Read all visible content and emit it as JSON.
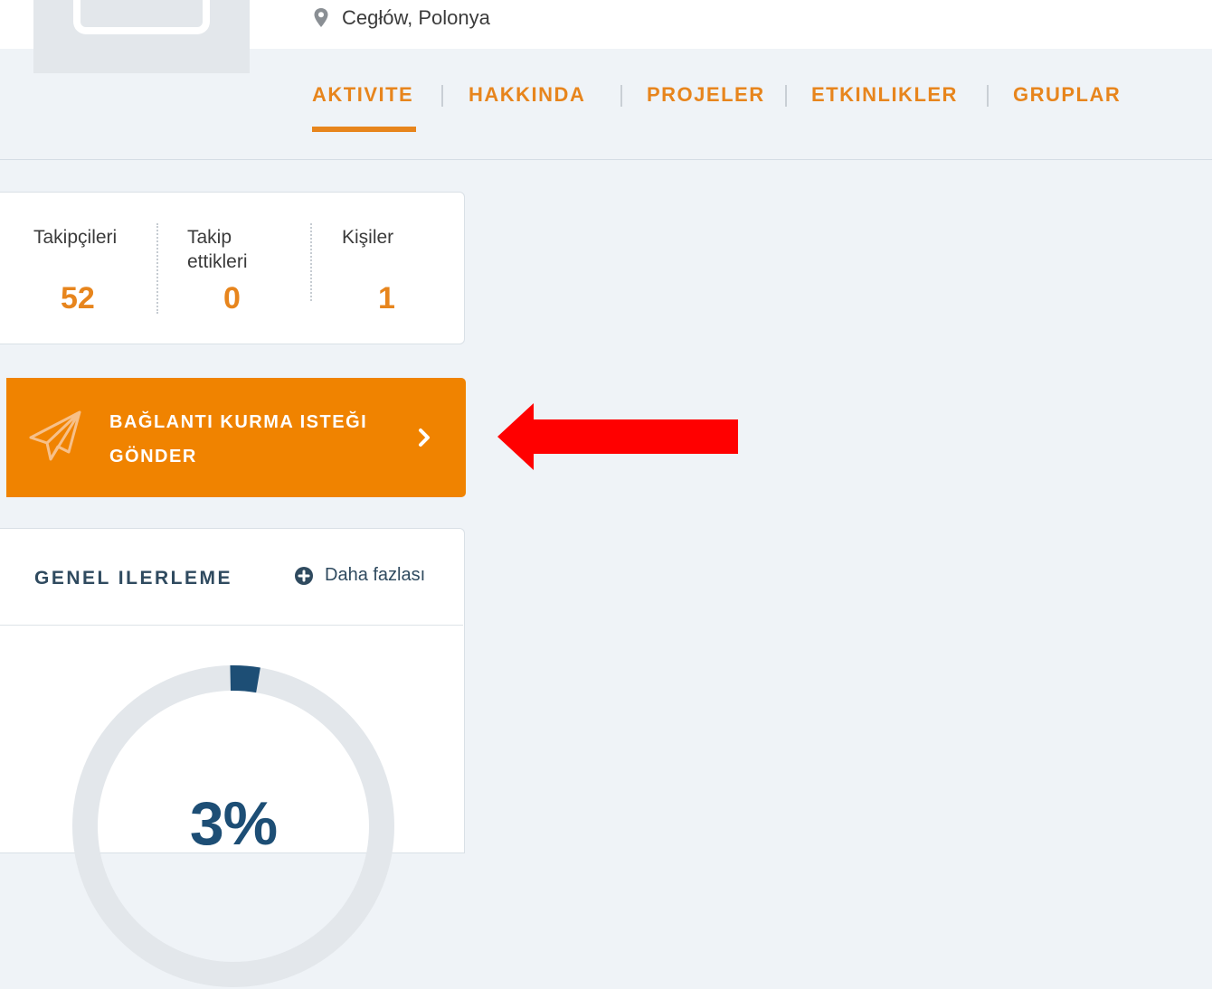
{
  "profile": {
    "location": "Cegłów, Polonya"
  },
  "tabs": [
    {
      "label": "AKTIVITE",
      "active": true
    },
    {
      "label": "HAKKINDA"
    },
    {
      "label": "PROJELER"
    },
    {
      "label": "ETKINLIKLER"
    },
    {
      "label": "GRUPLAR"
    }
  ],
  "stats": [
    {
      "label": "Takipçileri",
      "value": "52"
    },
    {
      "label": "Takip ettikleri",
      "value": "0"
    },
    {
      "label": "Kişiler",
      "value": "1"
    }
  ],
  "cta": {
    "label_line1": "BAĞLANTI KURMA ISTEĞI",
    "label_line2": "GÖNDER",
    "icon": "paper-plane-icon"
  },
  "progress": {
    "title": "GENEL ILERLEME",
    "more_label": "Daha fazlası",
    "value_label": "3%",
    "percent": 3
  },
  "colors": {
    "accent": "#e7851d",
    "button": "#f08300",
    "annotation_arrow": "#ff0000",
    "progress_fill": "#1d4e75",
    "progress_track": "#e3e7eb"
  }
}
